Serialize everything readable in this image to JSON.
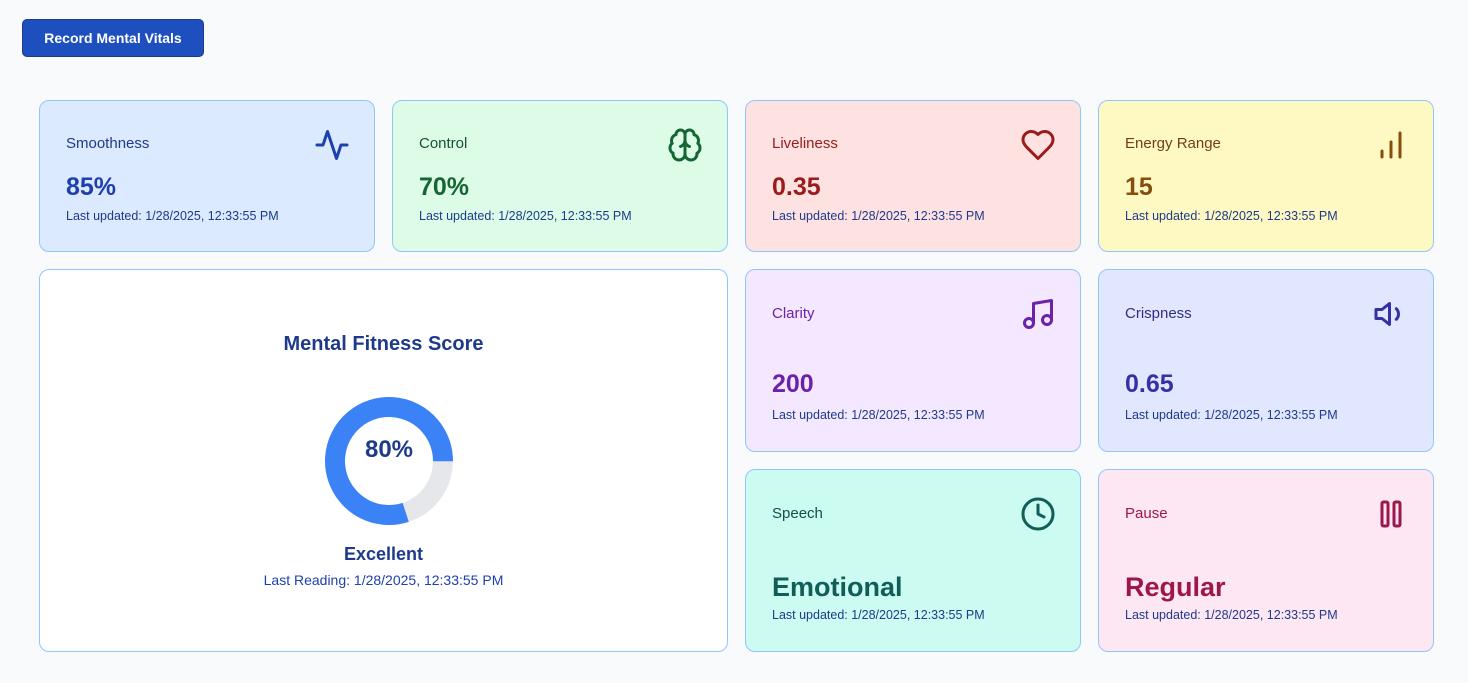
{
  "toolbar": {
    "record_label": "Record Mental Vitals"
  },
  "colors": {
    "donut_fill": "#3b82f6",
    "donut_track": "#e5e7eb"
  },
  "cards": {
    "smoothness": {
      "label": "Smoothness",
      "value": "85%",
      "updated": "Last updated: 1/28/2025, 12:33:55 PM",
      "icon": "activity-icon"
    },
    "control": {
      "label": "Control",
      "value": "70%",
      "updated": "Last updated: 1/28/2025, 12:33:55 PM",
      "icon": "brain-icon"
    },
    "liveliness": {
      "label": "Liveliness",
      "value": "0.35",
      "updated": "Last updated: 1/28/2025, 12:33:55 PM",
      "icon": "heart-icon"
    },
    "energy_range": {
      "label": "Energy Range",
      "value": "15",
      "updated": "Last updated: 1/28/2025, 12:33:55 PM",
      "icon": "bar-chart-icon"
    },
    "clarity": {
      "label": "Clarity",
      "value": "200",
      "updated": "Last updated: 1/28/2025, 12:33:55 PM",
      "icon": "music-note-icon"
    },
    "crispness": {
      "label": "Crispness",
      "value": "0.65",
      "updated": "Last updated: 1/28/2025, 12:33:55 PM",
      "icon": "volume-icon"
    },
    "speech": {
      "label": "Speech",
      "value": "Emotional",
      "updated": "Last updated: 1/28/2025, 12:33:55 PM",
      "icon": "clock-icon"
    },
    "pause": {
      "label": "Pause",
      "value": "Regular",
      "updated": "Last updated: 1/28/2025, 12:33:55 PM",
      "icon": "pause-icon"
    }
  },
  "score": {
    "title": "Mental Fitness Score",
    "percent_label": "80%",
    "percent": 80,
    "status": "Excellent",
    "reading": "Last Reading: 1/28/2025, 12:33:55 PM"
  }
}
